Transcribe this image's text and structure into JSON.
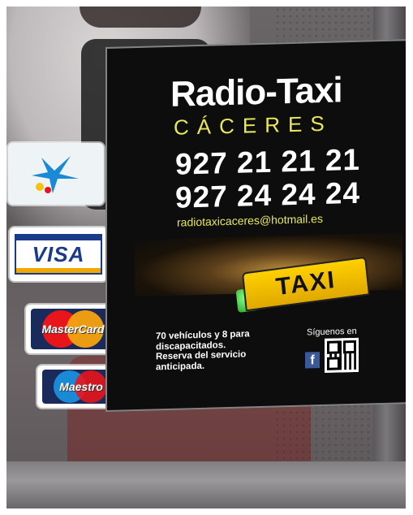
{
  "poster": {
    "title": "Radio-Taxi",
    "city": "CÁCERES",
    "phone1": "927 21 21 21",
    "phone2": "927 24 24 24",
    "email": "radiotaxicaceres@hotmail.es",
    "taxi_sign": "TAXI",
    "info_line1": "70 vehículos y 8 para",
    "info_line2": "discapacitados.",
    "info_line3": "Reserva del servicio",
    "info_line4": "anticipada.",
    "follow_label": "Síguenos en",
    "facebook_glyph": "f"
  },
  "stickers": {
    "visa": "VISA",
    "mastercard": "MasterCard",
    "maestro": "Maestro"
  },
  "colors": {
    "accent_yellow": "#e8e85a",
    "taxi_yellow": "#ffd000",
    "visa_blue": "#1a3a8a",
    "mc_red": "#e8151b",
    "mc_orange": "#f6a20f"
  }
}
